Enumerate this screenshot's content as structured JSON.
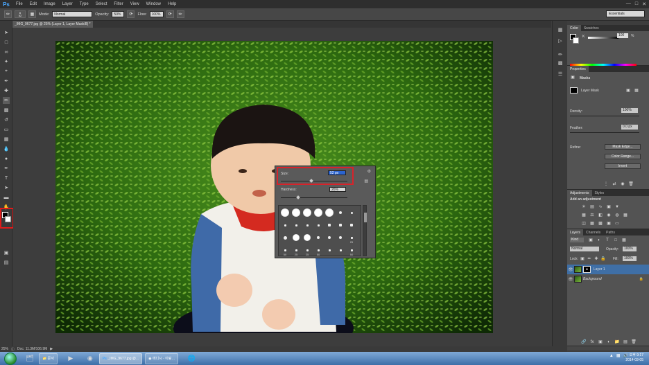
{
  "menubar": {
    "logo": "Ps",
    "items": [
      "File",
      "Edit",
      "Image",
      "Layer",
      "Type",
      "Select",
      "Filter",
      "View",
      "Window",
      "Help"
    ],
    "window_controls": [
      "—",
      "□",
      "✕"
    ]
  },
  "options": {
    "brush_size": "52",
    "mode_label": "Mode:",
    "mode_value": "Normal",
    "opacity_label": "Opacity:",
    "opacity_value": "50%",
    "flow_label": "Flow:",
    "flow_value": "100%",
    "workspace": "Essentials"
  },
  "document": {
    "tab_label": "_IMG_9677.jpg @ 25% (Layer 1, Layer Mask/8) *",
    "zoom": "25%",
    "doc_info": "Doc: 11.3M/106.9M"
  },
  "brush_popup": {
    "size_label": "Size:",
    "size_value": "52 px",
    "hardness_label": "Hardness:",
    "hardness_value": "26%",
    "size_fraction": 0.46,
    "hardness_fraction": 0.26,
    "brush_rows": [
      [
        {
          "kind": "soft",
          "size": 12,
          "label": ""
        },
        {
          "kind": "soft",
          "size": 12,
          "label": ""
        },
        {
          "kind": "soft",
          "size": 12,
          "label": ""
        },
        {
          "kind": "soft",
          "size": 12,
          "label": ""
        },
        {
          "kind": "soft",
          "size": 12,
          "label": ""
        },
        {
          "kind": "dot",
          "size": 4,
          "label": ""
        },
        {
          "kind": "dot",
          "size": 3,
          "label": ""
        }
      ],
      [
        {
          "kind": "small",
          "size": 3,
          "label": ""
        },
        {
          "kind": "small",
          "size": 3,
          "label": ""
        },
        {
          "kind": "small",
          "size": 3,
          "label": ""
        },
        {
          "kind": "small",
          "size": 3,
          "label": ""
        },
        {
          "kind": "small",
          "size": 4,
          "label": ""
        },
        {
          "kind": "small",
          "size": 4,
          "label": ""
        },
        {
          "kind": "small",
          "size": 4,
          "label": ""
        }
      ],
      [
        {
          "kind": "dot",
          "size": 5,
          "label": ""
        },
        {
          "kind": "soft",
          "size": 10,
          "label": ""
        },
        {
          "kind": "soft",
          "size": 10,
          "label": ""
        },
        {
          "kind": "dot",
          "size": 4,
          "label": ""
        },
        {
          "kind": "dot",
          "size": 4,
          "label": ""
        },
        {
          "kind": "dot",
          "size": 4,
          "label": ""
        },
        {
          "kind": "small",
          "size": 3,
          "label": "25"
        }
      ],
      [
        {
          "kind": "small",
          "size": 3,
          "label": "50"
        },
        {
          "kind": "small",
          "size": 3,
          "label": "25"
        },
        {
          "kind": "small",
          "size": 3,
          "label": "25"
        },
        {
          "kind": "small",
          "size": 3,
          "label": "50"
        },
        {
          "kind": "small",
          "size": 3,
          "label": ""
        },
        {
          "kind": "small",
          "size": 3,
          "label": ""
        },
        {
          "kind": "small",
          "size": 3,
          "label": "50"
        }
      ]
    ]
  },
  "color_panel": {
    "tabs": [
      "Color",
      "Swatches"
    ],
    "k_label": "K",
    "k_value": "100",
    "k_percent": "%"
  },
  "properties_panel": {
    "tab": "Properties",
    "section_title": "Masks",
    "layer_mask_label": "Layer Mask",
    "density_label": "Density:",
    "density_value": "100%",
    "feather_label": "Feather:",
    "feather_value": "0.0 px",
    "refine_label": "Refine:",
    "buttons": [
      "Mask Edge...",
      "Color Range...",
      "Invert"
    ]
  },
  "adjustments_panel": {
    "tabs": [
      "Adjustments",
      "Styles"
    ],
    "title": "Add an adjustment"
  },
  "layers_panel": {
    "tabs": [
      "Layers",
      "Channels",
      "Paths"
    ],
    "kind_filter": "Kind",
    "blend_mode": "Normal",
    "opacity_label": "Opacity:",
    "opacity_value": "100%",
    "lock_label": "Lock:",
    "fill_label": "Fill:",
    "fill_value": "100%",
    "layers": [
      {
        "name": "Layer 1",
        "selected": true,
        "has_mask": true
      },
      {
        "name": "Background",
        "selected": false,
        "has_mask": false
      }
    ]
  },
  "taskbar": {
    "windows": [
      {
        "label": "문서",
        "icon": "folder-icon"
      },
      {
        "label": "_IMG_9677.jpg @...",
        "icon": "photoshop-icon",
        "active": true
      },
      {
        "label": "에디시 - 이림…",
        "icon": "browser-icon"
      }
    ],
    "time": "오후 9:17",
    "date": "2014-03-05"
  }
}
